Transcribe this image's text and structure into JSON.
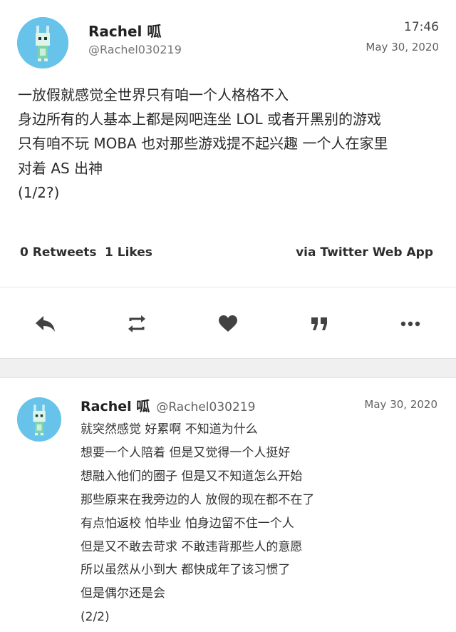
{
  "tweet": {
    "author_name": "Rachel 呱",
    "author_handle": "@Rachel030219",
    "time": "17:46",
    "date": "May 30, 2020",
    "lines": [
      "一放假就感觉全世界只有咱一个人格格不入",
      "身边所有的人基本上都是网吧连坐 LOL 或者开黑别的游戏",
      "只有咱不玩 MOBA 也对那些游戏提不起兴趣 一个人在家里",
      "对着 AS 出神",
      "(1/2?)"
    ],
    "retweets": "0 Retweets",
    "likes": "1 Likes",
    "source": "via Twitter Web App"
  },
  "actions": {
    "reply_icon": "reply-icon",
    "retweet_icon": "retweet-icon",
    "like_icon": "heart-icon",
    "quote_icon": "quote-icon",
    "more_icon": "more-icon"
  },
  "reply": {
    "author_name": "Rachel 呱",
    "author_handle": "@Rachel030219",
    "date": "May 30, 2020",
    "lines": [
      "就突然感觉 好累啊 不知道为什么",
      "想要一个人陪着 但是又觉得一个人挺好",
      "想融入他们的圈子 但是又不知道怎么开始",
      "那些原来在我旁边的人 放假的现在都不在了",
      "有点怕返校 怕毕业 怕身边留不住一个人",
      "但是又不敢去苛求 不敢违背那些人的意愿",
      "所以虽然从小到大 都快成年了该习惯了",
      "但是偶尔还是会",
      "(2/2)"
    ]
  },
  "colors": {
    "avatar_bg": "#67c3ea",
    "icon": "#424242",
    "separator": "#f0f0f0"
  }
}
